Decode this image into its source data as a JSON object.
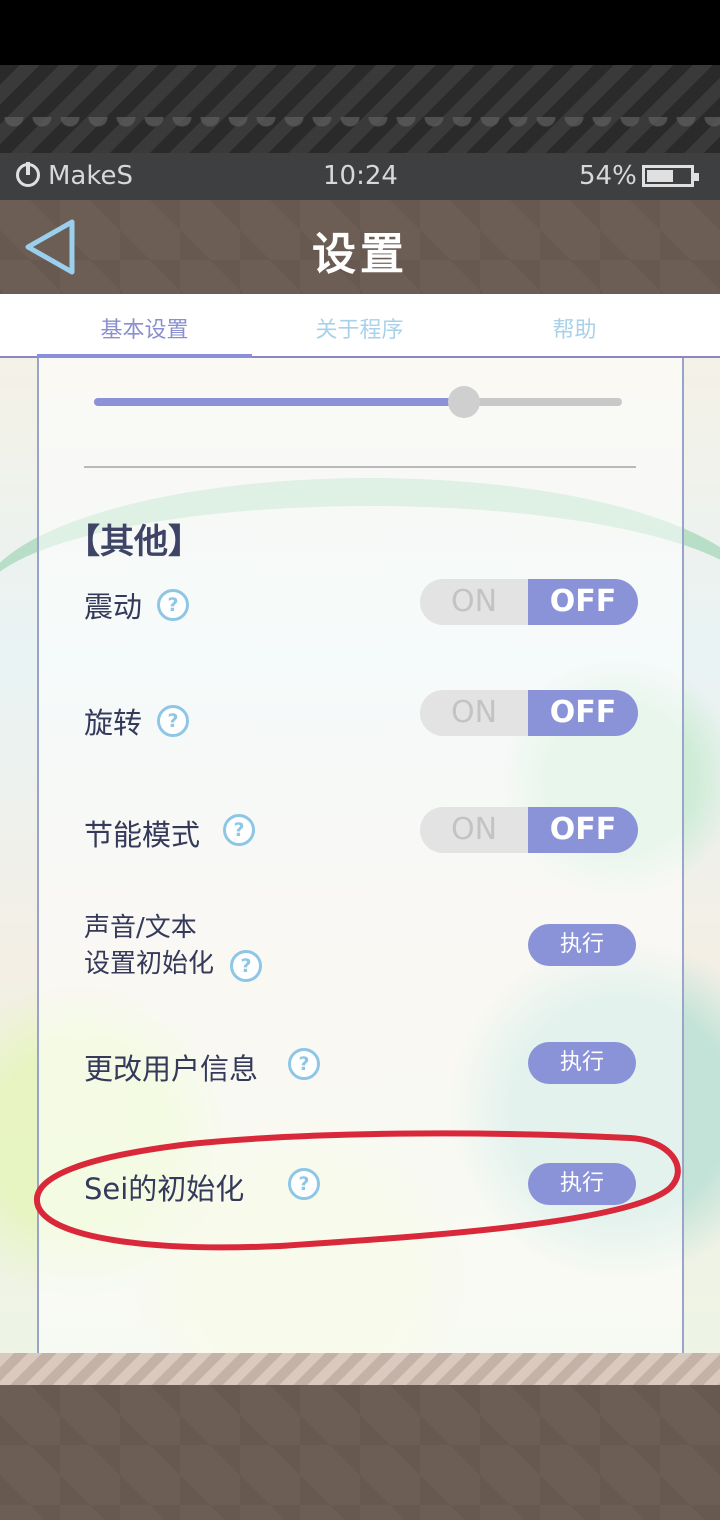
{
  "status_bar": {
    "brand": "MakeS",
    "time": "10:24",
    "battery": "54%"
  },
  "header": {
    "title": "设置"
  },
  "tabs": [
    {
      "label": "基本设置",
      "active": true
    },
    {
      "label": "关于程序",
      "active": false
    },
    {
      "label": "帮助",
      "active": false
    }
  ],
  "slider": {
    "value_fraction": 0.7
  },
  "section": {
    "title": "【其他】"
  },
  "toggles": [
    {
      "label": "震动",
      "on_text": "ON",
      "off_text": "OFF",
      "selected": "OFF"
    },
    {
      "label": "旋转",
      "on_text": "ON",
      "off_text": "OFF",
      "selected": "OFF"
    },
    {
      "label": "节能模式",
      "on_text": "ON",
      "off_text": "OFF",
      "selected": "OFF"
    }
  ],
  "actions": [
    {
      "label_line1": "声音/文本",
      "label_line2": "设置初始化",
      "button": "执行"
    },
    {
      "label": "更改用户信息",
      "button": "执行"
    },
    {
      "label": "Sei的初始化",
      "button": "执行"
    }
  ],
  "help_glyph": "?",
  "colors": {
    "accent": "#8b93d8",
    "annotation": "#d8283a"
  }
}
